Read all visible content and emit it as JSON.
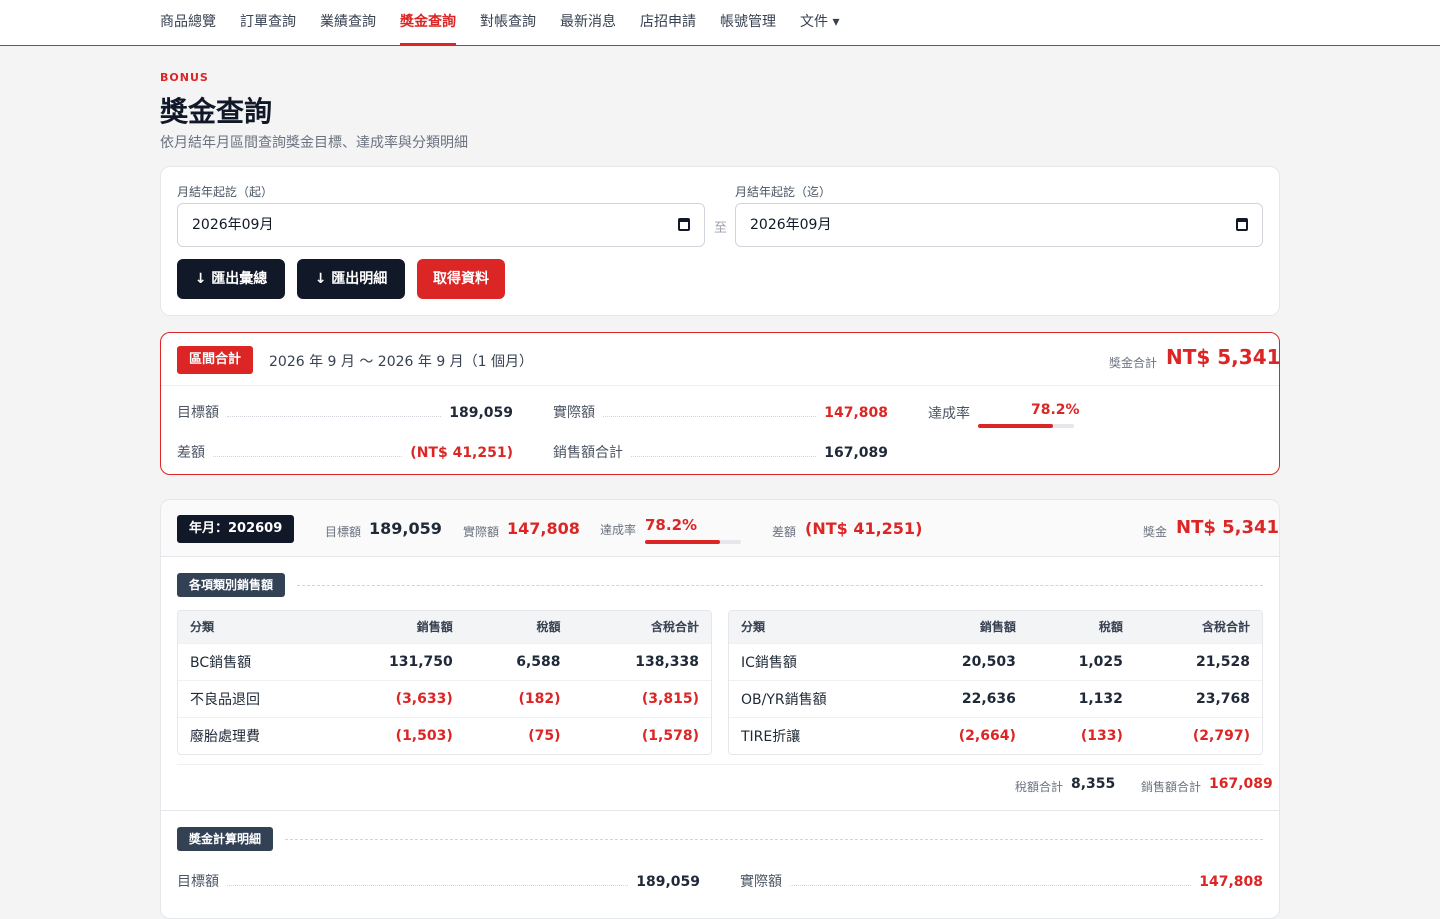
{
  "nav": [
    {
      "label": "商品總覽",
      "active": false
    },
    {
      "label": "訂單查詢",
      "active": false
    },
    {
      "label": "業績查詢",
      "active": false
    },
    {
      "label": "獎金查詢",
      "active": true
    },
    {
      "label": "對帳查詢",
      "active": false
    },
    {
      "label": "最新消息",
      "active": false
    },
    {
      "label": "店招申請",
      "active": false
    },
    {
      "label": "帳號管理",
      "active": false
    },
    {
      "label": "文件 ▾",
      "active": false
    }
  ],
  "page": {
    "eyebrow": "BONUS",
    "title": "獎金查詢",
    "subtitle": "依月結年月區間查詢獎金目標、達成率與分類明細"
  },
  "filter": {
    "start_label": "月結年起訖（起）",
    "start_value": "2026年09月",
    "to": "至",
    "end_label": "月結年起訖（迄）",
    "end_value": "2026年09月",
    "export_summary": "↓ 匯出彙總",
    "export_detail": "↓ 匯出明細",
    "fetch": "取得資料"
  },
  "summary": {
    "tag": "區間合計",
    "range": "2026 年 9 月 ～ 2026 年 9 月（1 個月）",
    "bonus_label": "獎金合計",
    "bonus_value": "NT$ 5,341",
    "target_label": "目標額",
    "target_value": "189,059",
    "actual_label": "實際額",
    "actual_value": "147,808",
    "rate_label": "達成率",
    "rate_value": "78.2%",
    "rate_fraction": 0.782,
    "diff_label": "差額",
    "diff_value": "(NT$ 41,251)",
    "sales_label": "銷售額合計",
    "sales_value": "167,089"
  },
  "month": {
    "tag": "年月：202609",
    "target_label": "目標額",
    "target_value": "189,059",
    "actual_label": "實際額",
    "actual_value": "147,808",
    "rate_label": "達成率",
    "rate_value": "78.2%",
    "rate_fraction": 0.782,
    "diff_label": "差額",
    "diff_value": "(NT$ 41,251)",
    "bonus_label": "獎金",
    "bonus_value": "NT$ 5,341",
    "section1": "各項類別銷售額",
    "columns": [
      "分類",
      "銷售額",
      "稅額",
      "含稅合計"
    ],
    "left_rows": [
      {
        "name": "BC銷售額",
        "sales": "131,750",
        "tax": "6,588",
        "total": "138,338",
        "neg": false
      },
      {
        "name": "不良品退回",
        "sales": "(3,633)",
        "tax": "(182)",
        "total": "(3,815)",
        "neg": true
      },
      {
        "name": "廢胎處理費",
        "sales": "(1,503)",
        "tax": "(75)",
        "total": "(1,578)",
        "neg": true
      }
    ],
    "right_rows": [
      {
        "name": "IC銷售額",
        "sales": "20,503",
        "tax": "1,025",
        "total": "21,528",
        "neg": false
      },
      {
        "name": "OB/YR銷售額",
        "sales": "22,636",
        "tax": "1,132",
        "total": "23,768",
        "neg": false
      },
      {
        "name": "TIRE折讓",
        "sales": "(2,664)",
        "tax": "(133)",
        "total": "(2,797)",
        "neg": true
      }
    ],
    "tax_total_label": "稅額合計",
    "tax_total_value": "8,355",
    "sales_total_label": "銷售額合計",
    "sales_total_value": "167,089",
    "section2": "獎金計算明細",
    "calc_target_label": "目標額",
    "calc_target_value": "189,059",
    "calc_actual_label": "實際額",
    "calc_actual_value": "147,808"
  }
}
